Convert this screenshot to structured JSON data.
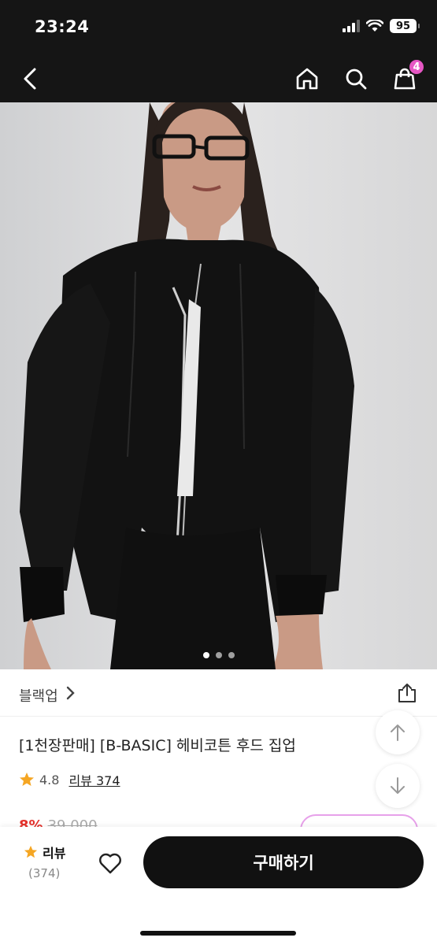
{
  "status_bar": {
    "time": "23:24",
    "battery": "95",
    "icons": [
      "signal-icon",
      "wifi-icon",
      "battery-icon"
    ]
  },
  "nav": {
    "icons": [
      "back-icon",
      "home-icon",
      "search-icon",
      "cart-icon"
    ],
    "cart_count": "4"
  },
  "gallery": {
    "image_count": 3,
    "active_index": 1
  },
  "brand": {
    "name": "블랙업"
  },
  "product": {
    "title": "[1천장판매] [B-BASIC] 헤비코튼 후드 집업",
    "rating": "4.8",
    "review_link": "리뷰 374",
    "discount": "8%",
    "original_price": "39,000"
  },
  "bottom_bar": {
    "review_label": "리뷰",
    "review_count": "(374)",
    "buy_label": "구매하기"
  },
  "colors": {
    "header_bg": "#151515",
    "badge": "#e657c4",
    "star": "#f5a623",
    "buy_button": "#111111"
  }
}
